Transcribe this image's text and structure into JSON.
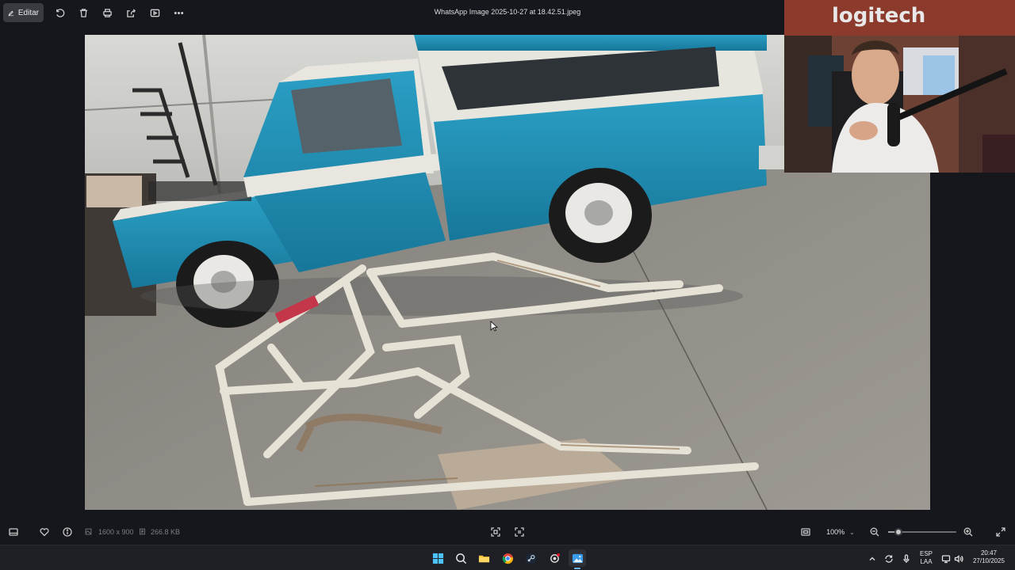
{
  "toolbar": {
    "edit_label": "Editar",
    "file_title": "WhatsApp Image 2025-10-27 at 18.42.51.jpeg"
  },
  "statusbar": {
    "dimensions": "1600 x 900",
    "file_size": "266.8 KB",
    "zoom": "100%",
    "zoom_level": 0.15
  },
  "taskbar": {
    "language_top": "ESP",
    "language_bottom": "LAA",
    "time": "20:47",
    "date": "27/10/2025"
  },
  "webcam": {
    "sign_text": "logitech"
  },
  "colors": {
    "accent": "#6cb6ff",
    "truck_blue": "#1e8fb5",
    "truck_white": "#e8e6df",
    "floor": "#8e8b85",
    "wall": "#cfcfcb"
  }
}
